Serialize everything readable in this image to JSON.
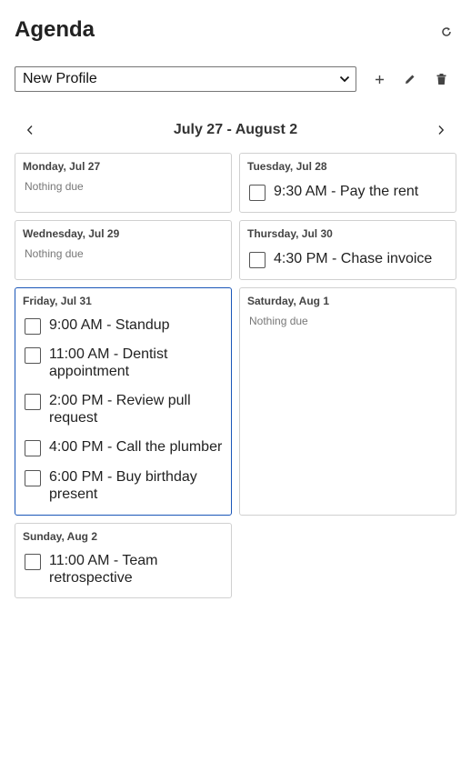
{
  "header": {
    "title": "Agenda",
    "refresh_icon": "refresh-icon"
  },
  "profile": {
    "selected": "New Profile",
    "add_icon": "plus-icon",
    "edit_icon": "pencil-icon",
    "delete_icon": "trash-icon"
  },
  "week": {
    "label": "July 27 - August 2",
    "prev_icon": "chevron-left-icon",
    "next_icon": "chevron-right-icon"
  },
  "days": [
    {
      "title": "Monday, Jul 27",
      "empty": "Nothing due",
      "tasks": []
    },
    {
      "title": "Tuesday, Jul 28",
      "tasks": [
        {
          "text": "9:30 AM - Pay the rent",
          "done": false
        }
      ]
    },
    {
      "title": "Wednesday, Jul 29",
      "empty": "Nothing due",
      "tasks": []
    },
    {
      "title": "Thursday, Jul 30",
      "tasks": [
        {
          "text": "4:30 PM - Chase invoice",
          "done": false
        }
      ]
    },
    {
      "title": "Friday, Jul 31",
      "highlighted": true,
      "tasks": [
        {
          "text": "9:00 AM - Standup",
          "done": false
        },
        {
          "text": "11:00 AM - Dentist appointment",
          "done": false
        },
        {
          "text": "2:00 PM - Review pull request",
          "done": false
        },
        {
          "text": "4:00 PM - Call the plumber",
          "done": false
        },
        {
          "text": "6:00 PM - Buy birthday present",
          "done": false
        }
      ]
    },
    {
      "title": "Saturday, Aug 1",
      "empty": "Nothing due",
      "tasks": []
    },
    {
      "title": "Sunday, Aug 2",
      "tasks": [
        {
          "text": "11:00 AM - Team retrospective",
          "done": false
        }
      ]
    }
  ],
  "colors": {
    "highlight_border": "#1a56b8",
    "card_border": "#d0d0d0"
  }
}
